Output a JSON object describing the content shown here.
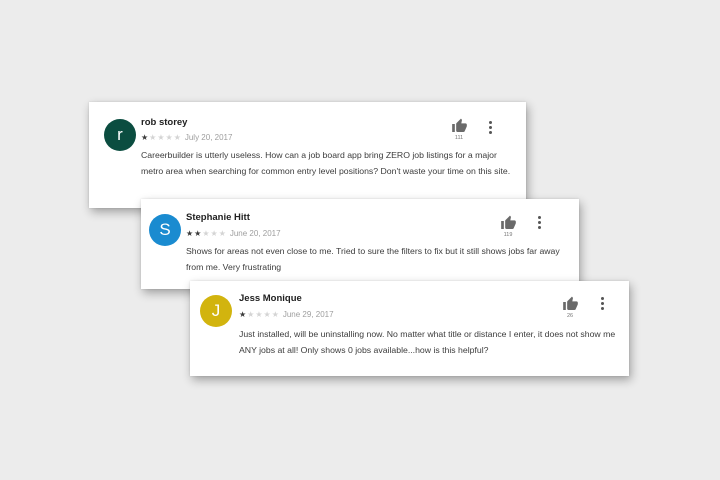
{
  "colors": {
    "background": "#ececec",
    "star_filled": "#3a3a3a",
    "star_empty": "#d4d4d4",
    "icon": "#6a6a6a"
  },
  "icons": {
    "helpful": "thumbs-up-icon",
    "menu": "more-vert-icon"
  },
  "reviews": [
    {
      "author": "rob storey",
      "avatar_letter": "r",
      "avatar_color": "#0b4d40",
      "rating": 1,
      "max_rating": 5,
      "date": "July 20, 2017",
      "text": "Careerbuilder is utterly useless. How can a job board app bring ZERO job listings for a major metro area when searching for common entry level positions? Don't waste your time on this site.",
      "helpful_count": "111"
    },
    {
      "author": "Stephanie Hitt",
      "avatar_letter": "S",
      "avatar_color": "#1a8bd0",
      "rating": 2,
      "max_rating": 5,
      "date": "June 20, 2017",
      "text": "Shows for areas not even close to me. Tried to sure the filters to fix but it still shows jobs far away from me. Very frustrating",
      "helpful_count": "119"
    },
    {
      "author": "Jess Monique",
      "avatar_letter": "J",
      "avatar_color": "#d2b40e",
      "rating": 1,
      "max_rating": 5,
      "date": "June 29, 2017",
      "text": "Just installed, will be uninstalling now. No matter what title or distance I enter, it does not show me ANY jobs at all! Only shows 0 jobs available...how is this helpful?",
      "helpful_count": "26"
    }
  ]
}
